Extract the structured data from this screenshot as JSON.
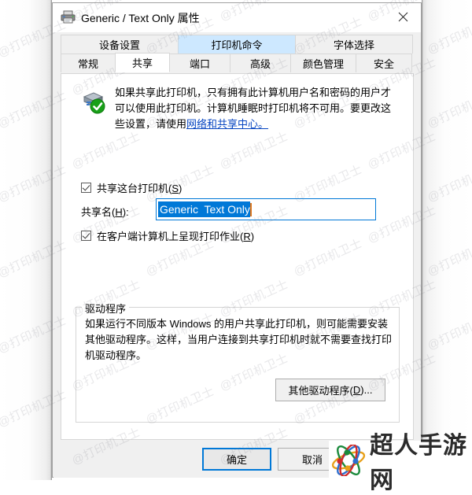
{
  "window": {
    "title": "Generic / Text Only 属性",
    "printer_icon": "printer-icon",
    "close_label": "✕"
  },
  "tabs": {
    "row1": [
      {
        "label": "设备设置",
        "state": "normal"
      },
      {
        "label": "打印机命令",
        "state": "hover"
      },
      {
        "label": "字体选择",
        "state": "normal"
      }
    ],
    "row2": [
      {
        "label": "常规",
        "state": "normal"
      },
      {
        "label": "共享",
        "state": "selected"
      },
      {
        "label": "端口",
        "state": "normal"
      },
      {
        "label": "高级",
        "state": "normal"
      },
      {
        "label": "颜色管理",
        "state": "normal"
      },
      {
        "label": "安全",
        "state": "normal"
      }
    ]
  },
  "sharing_page": {
    "info_icon": "shared-printer-ok-icon",
    "info_text_part1": "如果共享此打印机，只有拥有此计算机用户名和密码的用户才可以使用此打印机。计算机睡眠时打印机将不可用。要更改这些设置，请使用",
    "info_link": "网络和共享中心。",
    "share_checkbox": {
      "label_before": "共享这台打印机(",
      "accel": "S",
      "label_after": ")",
      "checked": true
    },
    "share_name": {
      "label_before": "共享名(",
      "accel": "H",
      "label_after": "):",
      "value": "Generic  Text Only",
      "selected": true
    },
    "render_checkbox": {
      "label_before": "在客户端计算机上呈现打印作业(",
      "accel": "R",
      "label_after": ")",
      "checked": true
    },
    "driver_group": {
      "legend": "驱动程序",
      "text": "如果运行不同版本 Windows 的用户共享此打印机，则可能需要安装其他驱动程序。这样，当用户连接到共享打印机时就不需要查找打印机驱动程序。",
      "button_before": "其他驱动程序(",
      "button_accel": "D",
      "button_after": ")..."
    }
  },
  "footer": {
    "ok_label": "确定",
    "cancel_label": "取消"
  },
  "watermarks": {
    "text": "@打印机卫士",
    "logo_text": "超人手游网"
  },
  "colors": {
    "accent": "#0078d7",
    "tab_hover": "#cde8ff",
    "link": "#0645c1",
    "caret": "#e0761a",
    "dialog_bg": "#f0f0f0"
  }
}
